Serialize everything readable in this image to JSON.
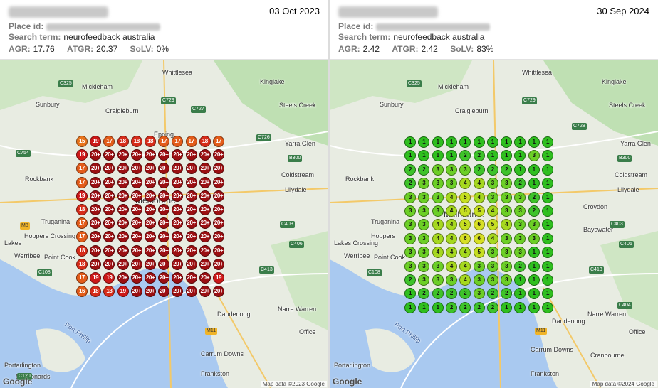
{
  "colors": {
    "rank_1": "#2fbf1f",
    "rank_2": "#3ec32a",
    "rank_3": "#6ccf26",
    "rank_4": "#a6d81f",
    "rank_5": "#c6df22",
    "rank_6": "#d7e025",
    "rank_15": "#e8741c",
    "rank_16": "#e35c1a",
    "rank_17": "#e35c1a",
    "rank_18": "#d62c1a",
    "rank_19": "#cc1818",
    "rank_20plus": "#9b0f12"
  },
  "left": {
    "date": "03 Oct 2023",
    "place_id_label": "Place id:",
    "search_label": "Search term:",
    "search_term": "neurofeedback australia",
    "agr_label": "AGR:",
    "agr": "17.76",
    "atgr_label": "ATGR:",
    "atgr": "20.37",
    "solv_label": "SoLV:",
    "solv": "0%",
    "attribution": "Map data ©2023 Google",
    "google": "Google",
    "grid": [
      [
        "15",
        "19",
        "17",
        "18",
        "18",
        "18",
        "17",
        "17",
        "17",
        "18",
        "17"
      ],
      [
        "19",
        "20+",
        "20+",
        "20+",
        "20+",
        "20+",
        "20+",
        "20+",
        "20+",
        "20+",
        "20+"
      ],
      [
        "17",
        "20+",
        "20+",
        "20+",
        "20+",
        "20+",
        "20+",
        "20+",
        "20+",
        "20+",
        "20+"
      ],
      [
        "17",
        "20+",
        "20+",
        "20+",
        "20+",
        "20+",
        "20+",
        "20+",
        "20+",
        "20+",
        "20+"
      ],
      [
        "19",
        "20+",
        "20+",
        "20+",
        "20+",
        "20+",
        "20+",
        "20+",
        "20+",
        "20+",
        "20+"
      ],
      [
        "18",
        "20+",
        "20+",
        "20+",
        "20+",
        "20+",
        "20+",
        "20+",
        "20+",
        "20+",
        "20+"
      ],
      [
        "17",
        "20+",
        "20+",
        "20+",
        "20+",
        "20+",
        "20+",
        "20+",
        "20+",
        "20+",
        "20+"
      ],
      [
        "17",
        "20+",
        "20+",
        "20+",
        "20+",
        "20+",
        "20+",
        "20+",
        "20+",
        "20+",
        "20+"
      ],
      [
        "18",
        "20+",
        "20+",
        "20+",
        "20+",
        "20+",
        "20+",
        "20+",
        "20+",
        "20+",
        "20+"
      ],
      [
        "18",
        "20+",
        "20+",
        "20+",
        "20+",
        "20+",
        "20+",
        "20+",
        "20+",
        "20+",
        "20+"
      ],
      [
        "17",
        "19",
        "19",
        "20+",
        "20+",
        "20+",
        "20+",
        "20+",
        "20+",
        "20+",
        "19"
      ],
      [
        "16",
        "18",
        "18",
        "19",
        "20+",
        "20+",
        "20+",
        "20+",
        "20+",
        "20+",
        "20+"
      ]
    ],
    "places": [
      {
        "name": "Whittlesea"
      },
      {
        "name": "Mickleham"
      },
      {
        "name": "Kinglake"
      },
      {
        "name": "Sunbury"
      },
      {
        "name": "Craigieburn"
      },
      {
        "name": "Steels Creek"
      },
      {
        "name": "Epping"
      },
      {
        "name": "Yarra Glen"
      },
      {
        "name": "Rockbank"
      },
      {
        "name": "Coldstream"
      },
      {
        "name": "Lilydale"
      },
      {
        "name": "Truganina"
      },
      {
        "name": "Hoppers Crossing"
      },
      {
        "name": "Lakes"
      },
      {
        "name": "Werribee"
      },
      {
        "name": "Point Cook"
      },
      {
        "name": "Dandenong"
      },
      {
        "name": "Narre Warren"
      },
      {
        "name": "Carrum Downs"
      },
      {
        "name": "Frankston"
      },
      {
        "name": "Portarlington"
      },
      {
        "name": "St Leonards"
      },
      {
        "name": "Port Phillip"
      },
      {
        "name": "Office"
      },
      {
        "name": "Melbourne"
      }
    ]
  },
  "right": {
    "date": "30 Sep 2024",
    "place_id_label": "Place id:",
    "search_label": "Search term:",
    "search_term": "neurofeedback australia",
    "agr_label": "AGR:",
    "agr": "2.42",
    "atgr_label": "ATGR:",
    "atgr": "2.42",
    "solv_label": "SoLV:",
    "solv": "83%",
    "attribution": "Map data ©2024 Google",
    "google": "Google",
    "grid": [
      [
        "1",
        "1",
        "1",
        "1",
        "1",
        "1",
        "1",
        "1",
        "1",
        "1",
        "1"
      ],
      [
        "1",
        "1",
        "1",
        "1",
        "2",
        "2",
        "1",
        "1",
        "1",
        "3",
        "1"
      ],
      [
        "2",
        "2",
        "3",
        "3",
        "3",
        "2",
        "2",
        "2",
        "1",
        "1",
        "1"
      ],
      [
        "2",
        "3",
        "3",
        "3",
        "4",
        "4",
        "3",
        "3",
        "2",
        "1",
        "1"
      ],
      [
        "3",
        "3",
        "3",
        "4",
        "5",
        "4",
        "3",
        "3",
        "3",
        "2",
        "1"
      ],
      [
        "3",
        "3",
        "3",
        "4",
        "5",
        "5",
        "4",
        "3",
        "3",
        "2",
        "1"
      ],
      [
        "3",
        "3",
        "4",
        "4",
        "5",
        "6",
        "5",
        "4",
        "3",
        "3",
        "1"
      ],
      [
        "3",
        "3",
        "4",
        "4",
        "6",
        "6",
        "4",
        "3",
        "3",
        "3",
        "1"
      ],
      [
        "3",
        "3",
        "4",
        "4",
        "4",
        "5",
        "3",
        "3",
        "3",
        "1",
        "1"
      ],
      [
        "3",
        "3",
        "3",
        "4",
        "4",
        "3",
        "3",
        "3",
        "2",
        "1",
        "1"
      ],
      [
        "2",
        "3",
        "3",
        "3",
        "4",
        "3",
        "3",
        "3",
        "1",
        "1",
        "1"
      ],
      [
        "1",
        "2",
        "2",
        "2",
        "2",
        "3",
        "2",
        "2",
        "1",
        "1",
        "1"
      ],
      [
        "1",
        "1",
        "1",
        "2",
        "2",
        "2",
        "2",
        "1",
        "1",
        "1",
        "1"
      ]
    ],
    "places": [
      {
        "name": "Whittlesea"
      },
      {
        "name": "Mickleham"
      },
      {
        "name": "Kinglake"
      },
      {
        "name": "Sunbury"
      },
      {
        "name": "Craigieburn"
      },
      {
        "name": "Steels Creek"
      },
      {
        "name": "Yarra Glen"
      },
      {
        "name": "Rockbank"
      },
      {
        "name": "Coldstream"
      },
      {
        "name": "Lilydale"
      },
      {
        "name": "Truganina"
      },
      {
        "name": "Hoppers"
      },
      {
        "name": "Lakes Crossing"
      },
      {
        "name": "Werribee"
      },
      {
        "name": "Point Cook"
      },
      {
        "name": "Croydon"
      },
      {
        "name": "Bayswater"
      },
      {
        "name": "Dandenong"
      },
      {
        "name": "Narre Warren"
      },
      {
        "name": "Carrum Downs"
      },
      {
        "name": "Frankston"
      },
      {
        "name": "Cranbourne"
      },
      {
        "name": "Office"
      },
      {
        "name": "Portarlington"
      },
      {
        "name": "Port Phillip"
      },
      {
        "name": "Melbourne"
      }
    ]
  }
}
